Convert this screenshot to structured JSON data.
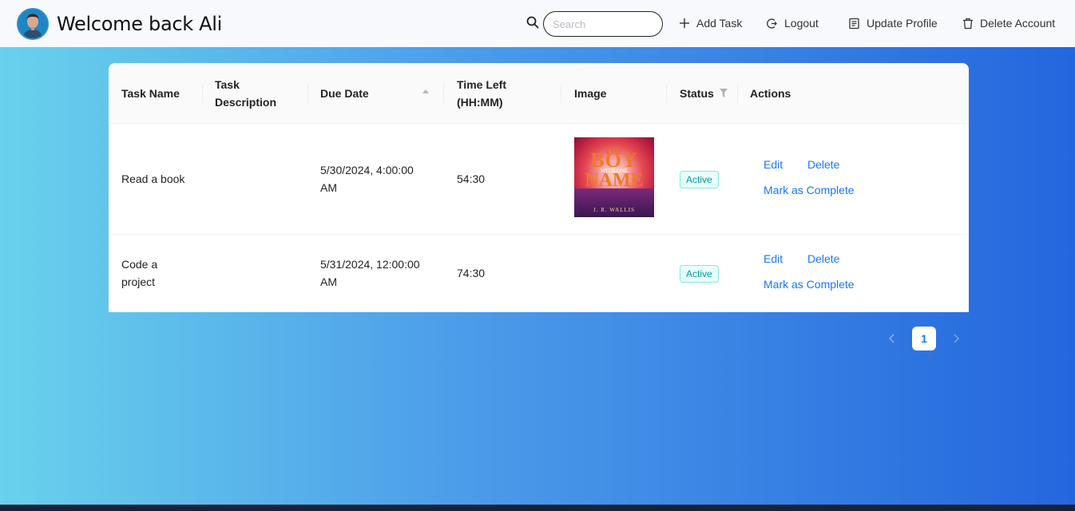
{
  "header": {
    "welcome": "Welcome back Ali",
    "search_placeholder": "Search",
    "add_task": "Add Task",
    "logout": "Logout",
    "update_profile": "Update Profile",
    "delete_account": "Delete Account"
  },
  "table": {
    "columns": [
      "Task Name",
      "Task Description",
      "Due Date",
      "Time Left (HH:MM)",
      "Image",
      "Status",
      "Actions"
    ],
    "col_task_desc_l1": "Task",
    "col_task_desc_l2": "Description",
    "col_time_l1": "Time Left",
    "col_time_l2": "(HH:MM)",
    "rows": [
      {
        "name": "Read a book",
        "description": "",
        "due_l1": "5/30/2024, 4:00:00",
        "due_l2": "AM",
        "time_left": "54:30",
        "image": {
          "title_l1": "THE",
          "title_l2": "BOY",
          "title_l3": "WITH ONE",
          "title_l4": "NAME",
          "author": "J. R. WALLIS"
        },
        "status": "Active",
        "edit": "Edit",
        "delete": "Delete",
        "complete": "Mark as Complete"
      },
      {
        "name_l1": "Code a",
        "name_l2": "project",
        "description": "",
        "due_l1": "5/31/2024, 12:00:00",
        "due_l2": "AM",
        "time_left": "74:30",
        "status": "Active",
        "edit": "Edit",
        "delete": "Delete",
        "complete": "Mark as Complete"
      }
    ]
  },
  "pagination": {
    "current": "1"
  },
  "colors": {
    "accent": "#1677ff",
    "badge": "#08979c",
    "gradient_left": "#69d1ec",
    "gradient_right": "#2466de"
  },
  "icons": [
    "avatar",
    "search-icon",
    "plus-icon",
    "logout-icon",
    "profile-icon",
    "trash-icon",
    "sort-icon",
    "filter-icon",
    "chevron-left-icon",
    "chevron-right-icon"
  ]
}
